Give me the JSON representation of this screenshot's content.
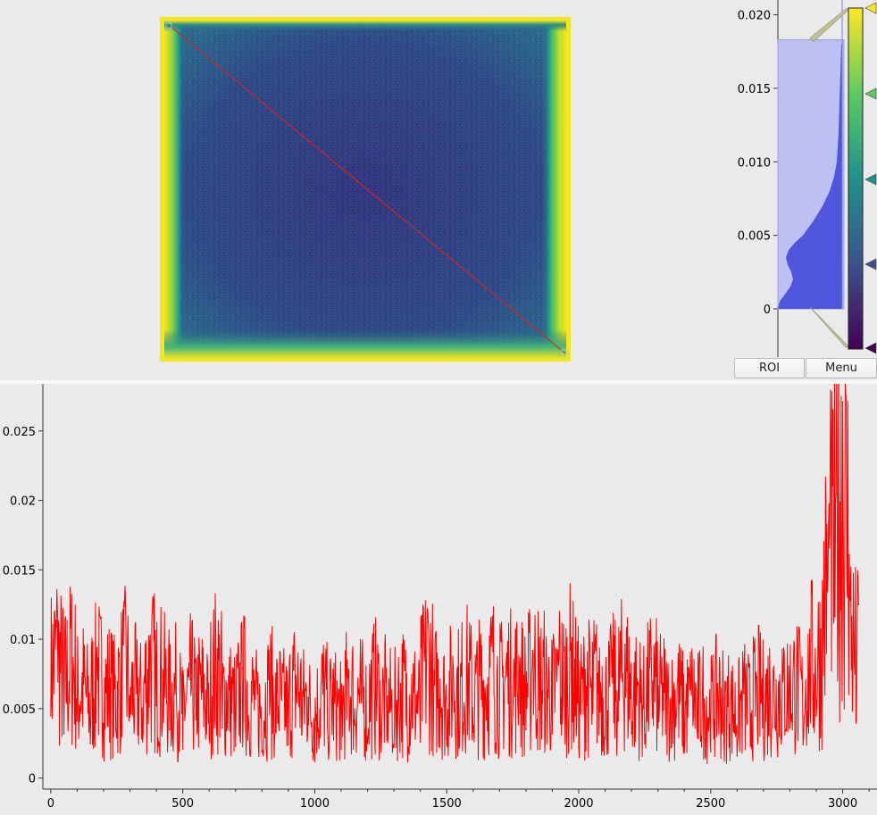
{
  "image_view": {
    "colormap": "viridis",
    "colors": {
      "frame": "#f3e51e",
      "background_dark": "#2d2e7a",
      "roi_line": "#d4241f"
    }
  },
  "histogram": {
    "ticks": [
      "0.020",
      "0.015",
      "0.010",
      "0.005",
      "0"
    ],
    "tick_values": [
      0.02,
      0.015,
      0.01,
      0.005,
      0
    ],
    "range": [
      -0.0028,
      0.0205
    ],
    "level_region": [
      0,
      0.0183
    ],
    "gradient_stops": [
      "#440154",
      "#3b528b",
      "#21918c",
      "#5ec962",
      "#fde725"
    ],
    "colors": {
      "region_fill": "#bcc0f2",
      "distribution": "#4f56dc"
    }
  },
  "buttons": {
    "roi_label": "ROI",
    "menu_label": "Menu"
  },
  "chart_data": {
    "type": "line",
    "title": "",
    "xlabel": "",
    "ylabel": "",
    "xlim": [
      -30,
      3130
    ],
    "ylim": [
      -0.0008,
      0.0284
    ],
    "x_ticks": [
      0,
      500,
      1000,
      1500,
      2000,
      2500,
      3000
    ],
    "x_tick_labels": [
      "0",
      "500",
      "1000",
      "1500",
      "2000",
      "2500",
      "3000"
    ],
    "y_ticks": [
      0,
      0.005,
      0.01,
      0.015,
      0.02,
      0.025
    ],
    "y_tick_labels": [
      "0",
      "0.005",
      "0.01",
      "0.015",
      "0.02",
      "0.025"
    ],
    "grid": false,
    "series": [
      {
        "color": "#ff0000",
        "x": [
          0,
          25,
          50,
          75,
          100,
          125,
          150,
          175,
          200,
          225,
          250,
          275,
          300,
          325,
          350,
          375,
          400,
          425,
          450,
          475,
          500,
          525,
          550,
          575,
          600,
          625,
          650,
          675,
          700,
          725,
          750,
          775,
          800,
          825,
          850,
          875,
          900,
          925,
          950,
          975,
          1000,
          1025,
          1050,
          1075,
          1100,
          1125,
          1150,
          1175,
          1200,
          1225,
          1250,
          1275,
          1300,
          1325,
          1350,
          1375,
          1400,
          1425,
          1450,
          1475,
          1500,
          1525,
          1550,
          1575,
          1600,
          1625,
          1650,
          1675,
          1700,
          1725,
          1750,
          1775,
          1800,
          1825,
          1850,
          1875,
          1900,
          1925,
          1950,
          1975,
          2000,
          2025,
          2050,
          2075,
          2100,
          2125,
          2150,
          2175,
          2200,
          2225,
          2250,
          2275,
          2300,
          2325,
          2350,
          2375,
          2400,
          2425,
          2450,
          2475,
          2500,
          2525,
          2550,
          2575,
          2600,
          2625,
          2650,
          2675,
          2700,
          2725,
          2750,
          2775,
          2800,
          2825,
          2850,
          2875,
          2900,
          2925,
          2950,
          2975,
          3000,
          3025,
          3050,
          3060
        ],
        "y": [
          0.0045,
          0.012,
          0.0032,
          0.0108,
          0.0041,
          0.0068,
          0.0025,
          0.0094,
          0.0038,
          0.0072,
          0.0029,
          0.0096,
          0.0044,
          0.0061,
          0.0033,
          0.0098,
          0.0052,
          0.0078,
          0.0035,
          0.0066,
          0.0021,
          0.0071,
          0.0042,
          0.0062,
          0.0028,
          0.0103,
          0.0036,
          0.0064,
          0.0023,
          0.0079,
          0.0039,
          0.0057,
          0.0019,
          0.0071,
          0.0034,
          0.0056,
          0.0024,
          0.0081,
          0.0031,
          0.0058,
          0.0012,
          0.0069,
          0.0029,
          0.0054,
          0.0021,
          0.0072,
          0.0038,
          0.0061,
          0.0025,
          0.0076,
          0.0033,
          0.0059,
          0.0022,
          0.0068,
          0.0037,
          0.0062,
          0.0026,
          0.0112,
          0.0041,
          0.0071,
          0.0028,
          0.0079,
          0.0036,
          0.0086,
          0.0033,
          0.0074,
          0.0042,
          0.0091,
          0.0038,
          0.0083,
          0.0046,
          0.0081,
          0.0035,
          0.0092,
          0.0049,
          0.0075,
          0.0032,
          0.0086,
          0.0045,
          0.0101,
          0.0022,
          0.0078,
          0.0039,
          0.0084,
          0.0028,
          0.0073,
          0.0041,
          0.0096,
          0.0032,
          0.0069,
          0.0025,
          0.0086,
          0.0036,
          0.0062,
          0.0022,
          0.0071,
          0.0018,
          0.0064,
          0.0029,
          0.0057,
          0.0019,
          0.0068,
          0.0026,
          0.0054,
          0.0016,
          0.0061,
          0.0023,
          0.0073,
          0.0029,
          0.0069,
          0.0032,
          0.0076,
          0.0036,
          0.0081,
          0.0024,
          0.0107,
          0.0045,
          0.0131,
          0.0166,
          0.0205,
          0.0271,
          0.0161,
          0.0041,
          0.0125
        ]
      }
    ]
  }
}
